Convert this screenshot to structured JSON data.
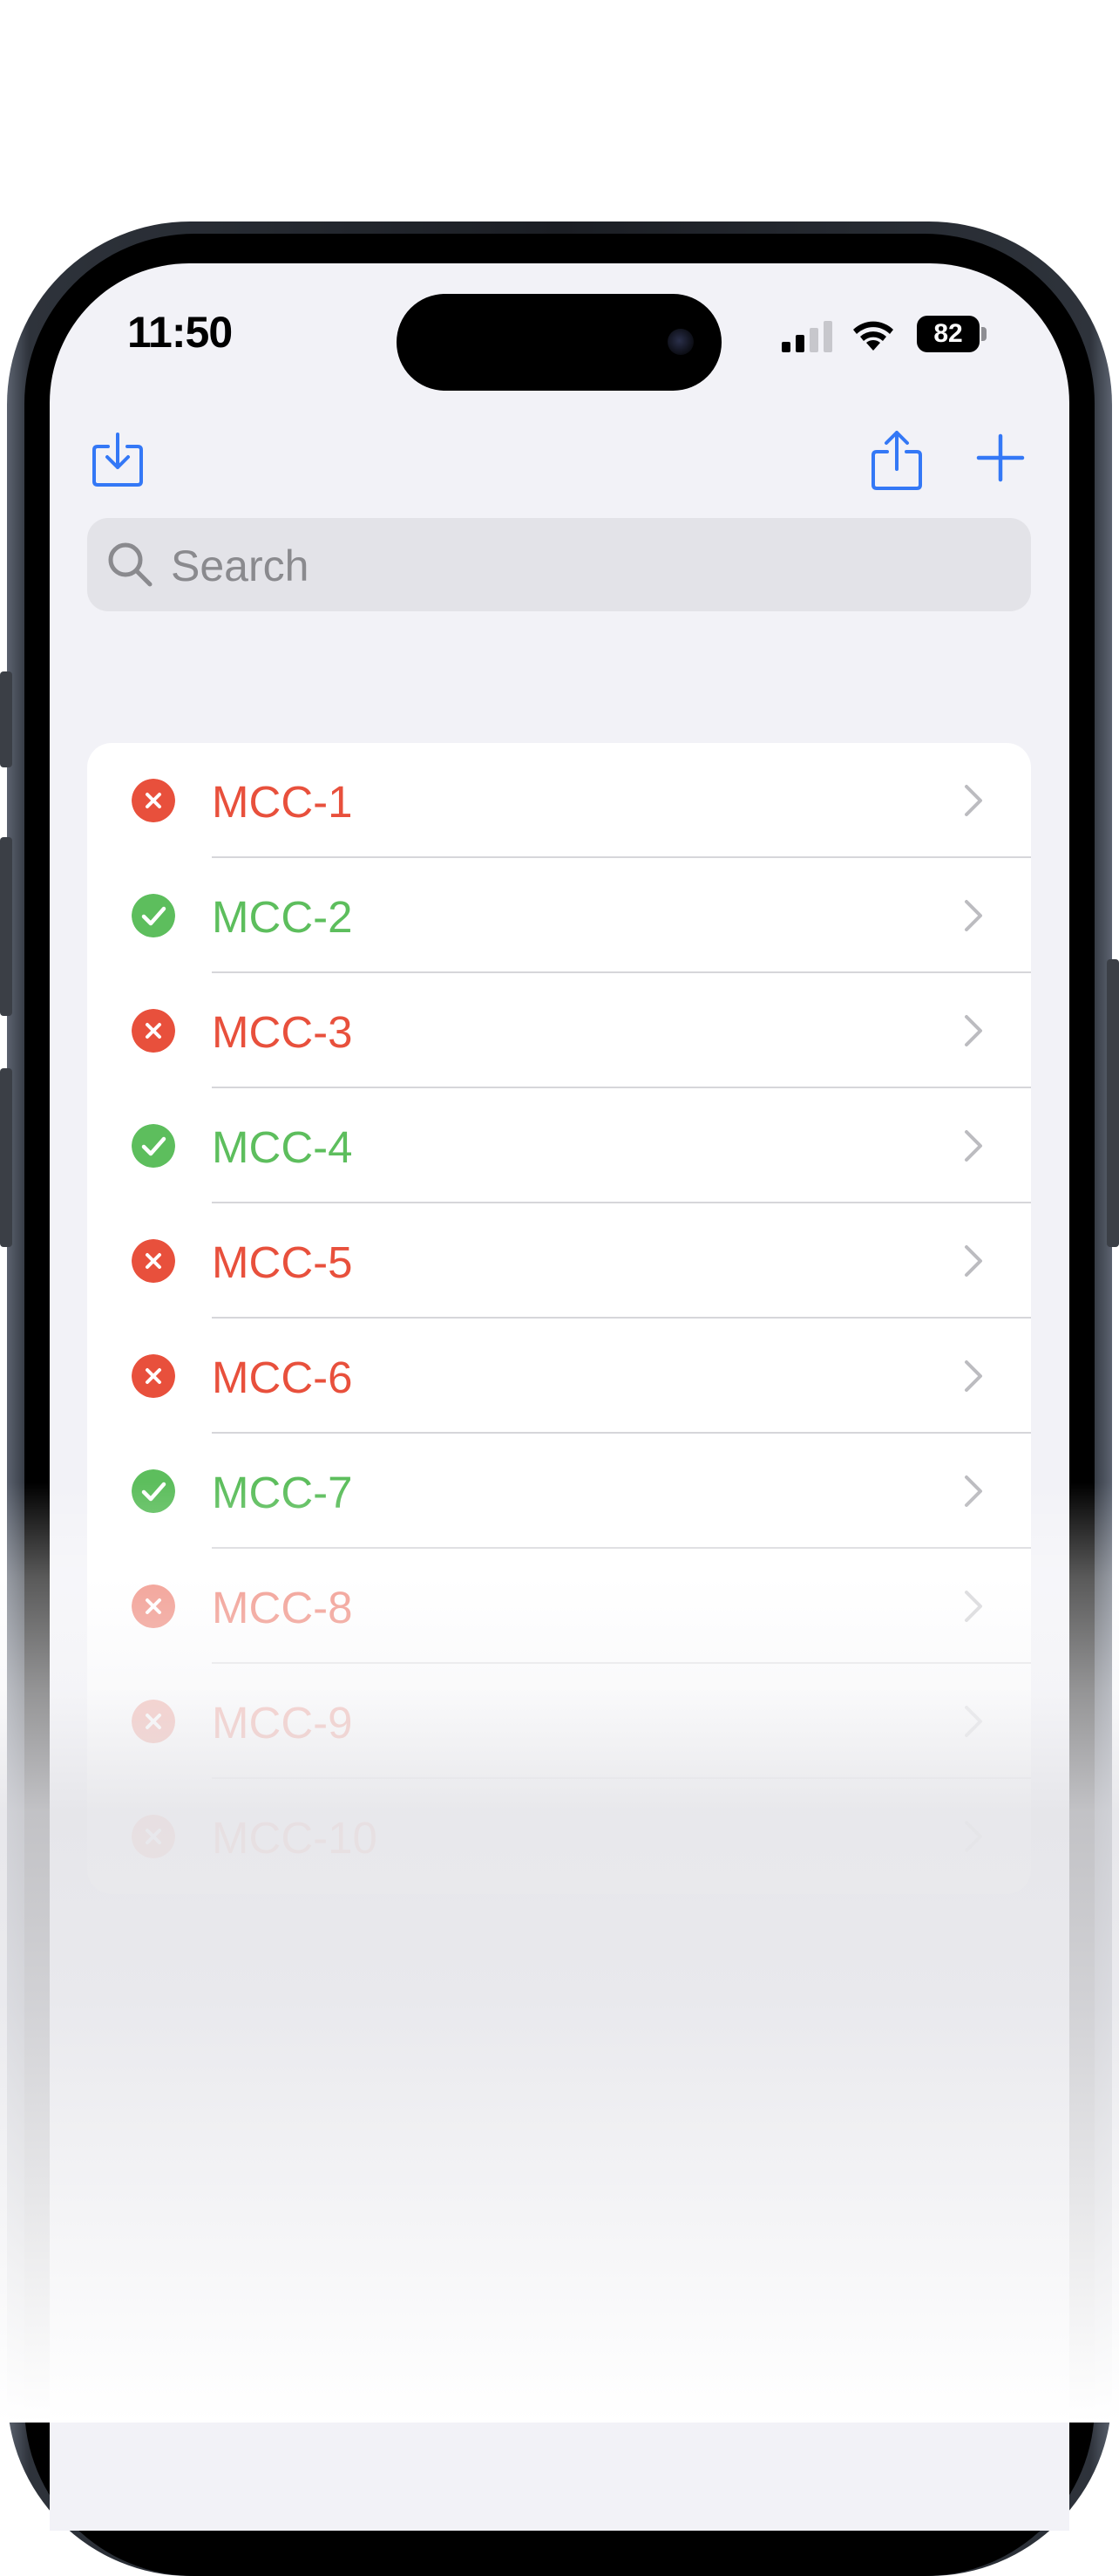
{
  "status_bar": {
    "time": "11:50",
    "battery": "82"
  },
  "toolbar": {
    "import_icon": "tray-arrow-down-icon",
    "share_icon": "square-arrow-up-icon",
    "add_icon": "plus-icon"
  },
  "search": {
    "placeholder": "Search",
    "value": ""
  },
  "colors": {
    "accent": "#3478f6",
    "fail": "#e8503c",
    "pass": "#5dbe5d"
  },
  "items": [
    {
      "label": "MCC-1",
      "status": "fail"
    },
    {
      "label": "MCC-2",
      "status": "pass"
    },
    {
      "label": "MCC-3",
      "status": "fail"
    },
    {
      "label": "MCC-4",
      "status": "pass"
    },
    {
      "label": "MCC-5",
      "status": "fail"
    },
    {
      "label": "MCC-6",
      "status": "fail"
    },
    {
      "label": "MCC-7",
      "status": "pass"
    },
    {
      "label": "MCC-8",
      "status": "fail"
    },
    {
      "label": "MCC-9",
      "status": "fail"
    },
    {
      "label": "MCC-10",
      "status": "fail"
    }
  ]
}
